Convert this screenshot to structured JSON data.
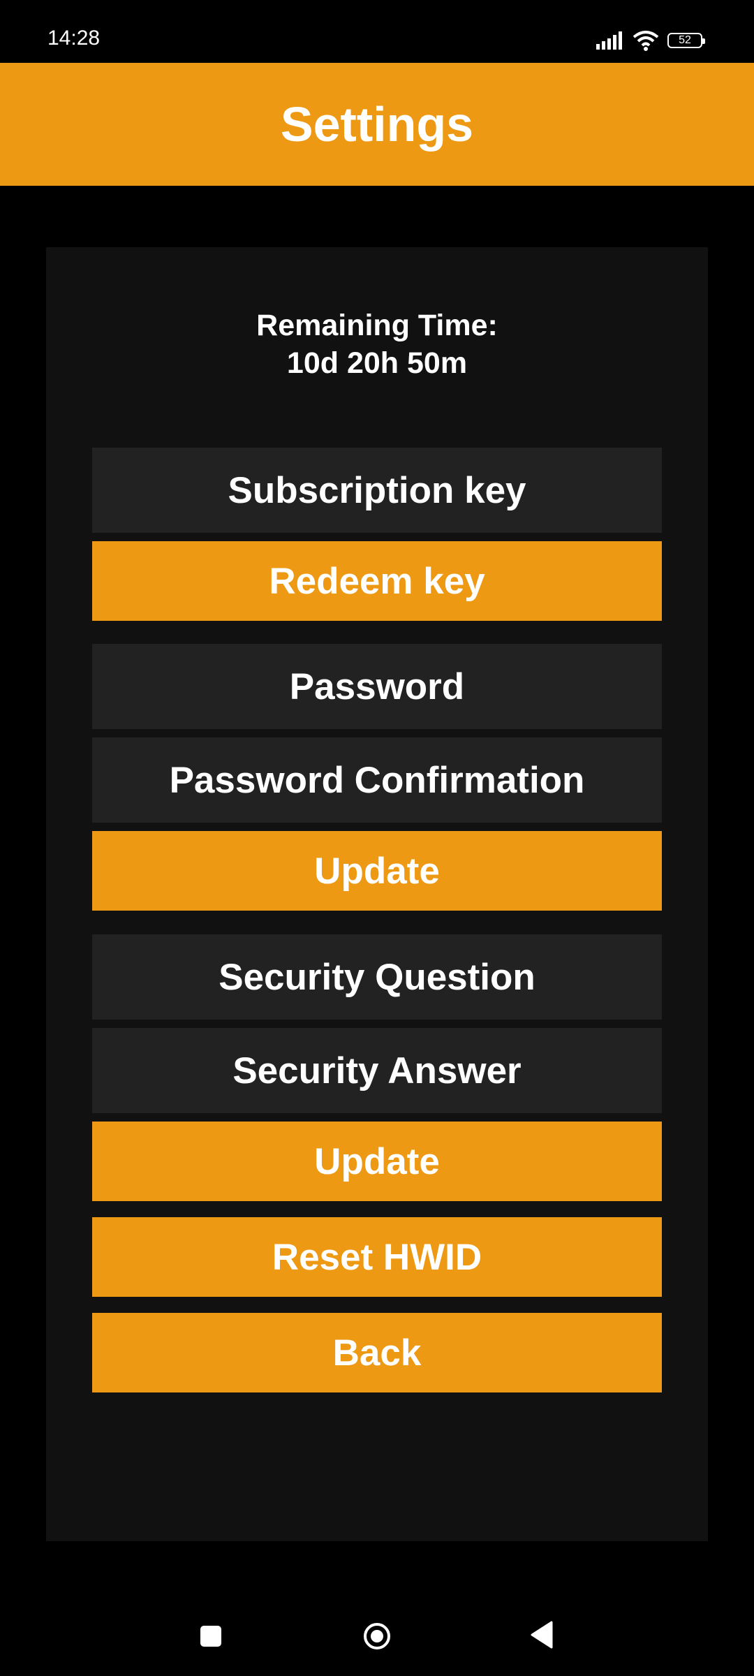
{
  "status_bar": {
    "time": "14:28",
    "battery_level": "52",
    "icons": [
      "signal-icon",
      "wifi-icon",
      "battery-icon"
    ]
  },
  "header": {
    "title": "Settings"
  },
  "remaining": {
    "label": "Remaining Time:",
    "value": "10d 20h 50m"
  },
  "subscription": {
    "key_placeholder": "Subscription key",
    "redeem_label": "Redeem key"
  },
  "password": {
    "password_placeholder": "Password",
    "confirm_placeholder": "Password Confirmation",
    "update_label": "Update"
  },
  "security": {
    "question_placeholder": "Security Question",
    "answer_placeholder": "Security Answer",
    "update_label": "Update"
  },
  "actions": {
    "reset_hwid_label": "Reset HWID",
    "back_label": "Back"
  },
  "nav": {
    "icons": [
      "recents-square-icon",
      "home-circle-icon",
      "back-triangle-icon"
    ]
  },
  "colors": {
    "accent": "#ee9913",
    "field_bg": "#222222",
    "panel_bg": "#111111",
    "page_bg": "#000000",
    "text": "#ffffff"
  }
}
